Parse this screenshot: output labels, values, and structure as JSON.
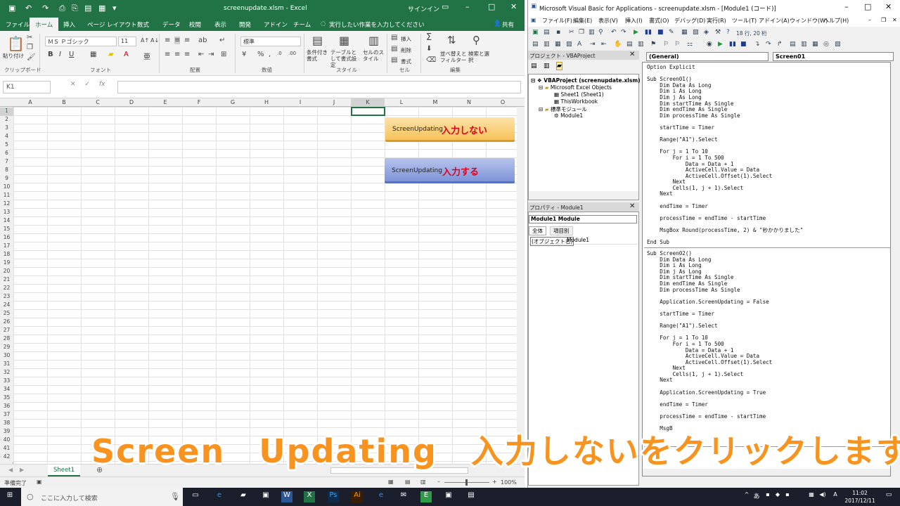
{
  "excel": {
    "title": "screenupdate.xlsm  -  Excel",
    "signin": "サインイン",
    "tabs": [
      "ファイル",
      "ホーム",
      "挿入",
      "ページ レイアウト",
      "数式",
      "データ",
      "校閲",
      "表示",
      "開発",
      "アドイン",
      "チーム"
    ],
    "tellme": "実行したい作業を入力してください",
    "share": "共有",
    "ribbon": {
      "paste": "貼り付け",
      "font_name": "ＭＳ Ｐゴシック",
      "font_size": "11",
      "number_format": "標準",
      "groups": [
        "クリップボード",
        "フォント",
        "配置",
        "数値",
        "スタイル",
        "セル",
        "編集"
      ],
      "cond_format": "条件付き書式",
      "table_format": "テーブルとして書式設定",
      "cell_style": "セルのスタイル",
      "insert": "挿入",
      "delete": "削除",
      "format": "書式",
      "sort": "並べ替えとフィルター",
      "find": "検索と選択"
    },
    "namebox": "K1",
    "fx": "fx",
    "columns": [
      "A",
      "B",
      "C",
      "D",
      "E",
      "F",
      "G",
      "H",
      "I",
      "J",
      "K",
      "L",
      "M",
      "N",
      "O"
    ],
    "rows": [
      "1",
      "2",
      "3",
      "4",
      "5",
      "6",
      "7",
      "8",
      "9",
      "10",
      "11",
      "12",
      "13",
      "14",
      "15",
      "16",
      "17",
      "18",
      "19",
      "20",
      "21",
      "22",
      "23",
      "24",
      "25",
      "26",
      "27",
      "28",
      "29",
      "30",
      "31",
      "32",
      "33",
      "34",
      "35",
      "36",
      "37",
      "38",
      "39",
      "40",
      "41",
      "42"
    ],
    "button1": {
      "label": "ScreenUpdating",
      "emphasis": "入力しない"
    },
    "button2": {
      "label": "ScreenUpdating",
      "emphasis": "入力する"
    },
    "sheet_tab": "Sheet1",
    "status_left": "準備完了",
    "zoom": "100%"
  },
  "vba": {
    "title": "Microsoft Visual Basic for Applications - screenupdate.xlsm - [Module1 (コード)]",
    "menu": [
      "ファイル(F)",
      "編集(E)",
      "表示(V)",
      "挿入(I)",
      "書式(O)",
      "デバッグ(D)",
      "実行(R)",
      "ツール(T)",
      "アドイン(A)",
      "ウィンドウ(W)",
      "ヘルプ(H)"
    ],
    "position": "18 行, 20 桁",
    "project_header": "プロジェクト - VBAProject",
    "tree": [
      "VBAProject (screenupdate.xlsm)",
      "Microsoft Excel Objects",
      "Sheet1 (Sheet1)",
      "ThisWorkbook",
      "標準モジュール",
      "Module1"
    ],
    "props_header": "プロパティ - Module1",
    "props_object": "Module1  Module",
    "props_tabs": [
      "全体",
      "項目別"
    ],
    "props_row": {
      "name": "(オブジェクト名)",
      "value": "Module1"
    },
    "combo_general": "(General)",
    "combo_proc": "Screen01",
    "code_block1": "Option Explicit\n\nSub Screen01()\n    Dim Data As Long\n    Dim i As Long\n    Dim j As Long\n    Dim startTime As Single\n    Dim endTime As Single\n    Dim processTime As Single\n\n    startTime = Timer\n\n    Range(\"A1\").Select\n\n    For j = 1 To 10\n        For i = 1 To 500\n            Data = Data + 1\n            ActiveCell.Value = Data\n            ActiveCell.Offset(1).Select\n        Next\n        Cells(1, j + 1).Select\n    Next\n\n    endTime = Timer\n\n    processTime = endTime - startTime\n\n    MsgBox Round(processTime, 2) & \"秒かかりました\"\n\nEnd Sub",
    "code_block2": "Sub Screen02()\n    Dim Data As Long\n    Dim i As Long\n    Dim j As Long\n    Dim startTime As Single\n    Dim endTime As Single\n    Dim processTime As Single\n\n    Application.ScreenUpdating = False\n\n    startTime = Timer\n\n    Range(\"A1\").Select\n\n    For j = 1 To 10\n        For i = 1 To 500\n            Data = Data + 1\n            ActiveCell.Value = Data\n            ActiveCell.Offset(1).Select\n        Next\n        Cells(1, j + 1).Select\n    Next\n\n    Application.ScreenUpdating = True\n\n    endTime = Timer\n\n    processTime = endTime - startTime\n\n    MsgB"
  },
  "taskbar": {
    "search": "ここに入力して検索",
    "time": "11:02",
    "date": "2017/12/11"
  },
  "caption": "Screen　Updating　入力しないをクリックします。",
  "colors": {
    "excel_green": "#217346",
    "caption_orange": "#f7931e",
    "emphasis_red": "#e0001b"
  }
}
